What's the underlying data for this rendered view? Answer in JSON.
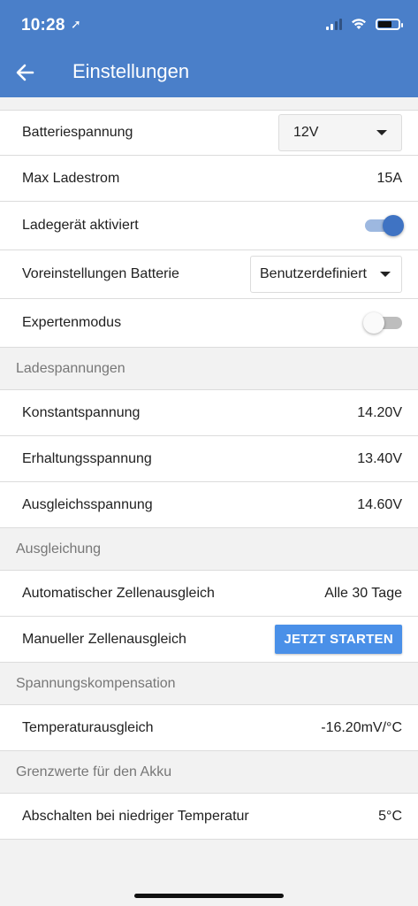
{
  "status_bar": {
    "time": "10:28",
    "location_glyph": "➚"
  },
  "header": {
    "title": "Einstellungen"
  },
  "settings": {
    "battery_voltage": {
      "label": "Batteriespannung",
      "value": "12V"
    },
    "max_charge_current": {
      "label": "Max Ladestrom",
      "value": "15A"
    },
    "charger_enabled": {
      "label": "Ladegerät aktiviert",
      "on": true
    },
    "battery_presets": {
      "label": "Voreinstellungen Batterie",
      "value": "Benutzerdefiniert"
    },
    "expert_mode": {
      "label": "Expertenmodus",
      "on": false
    }
  },
  "sections": {
    "charge_voltages": {
      "title": "Ladespannungen",
      "absorption": {
        "label": "Konstantspannung",
        "value": "14.20V"
      },
      "float": {
        "label": "Erhaltungsspannung",
        "value": "13.40V"
      },
      "equalization": {
        "label": "Ausgleichsspannung",
        "value": "14.60V"
      }
    },
    "equalization": {
      "title": "Ausgleichung",
      "automatic": {
        "label": "Automatischer Zellenausgleich",
        "value": "Alle 30 Tage"
      },
      "manual": {
        "label": "Manueller Zellenausgleich",
        "button": "JETZT STARTEN"
      }
    },
    "voltage_compensation": {
      "title": "Spannungskompensation",
      "temperature": {
        "label": "Temperaturausgleich",
        "value": "-16.20mV/°C"
      }
    },
    "battery_limits": {
      "title": "Grenzwerte für den Akku",
      "low_temp_cutoff": {
        "label": "Abschalten bei niedriger Temperatur",
        "value": "5°C"
      }
    }
  },
  "colors": {
    "header": "#4a7fc9",
    "accent": "#3f73c3",
    "button": "#4a90e8"
  }
}
